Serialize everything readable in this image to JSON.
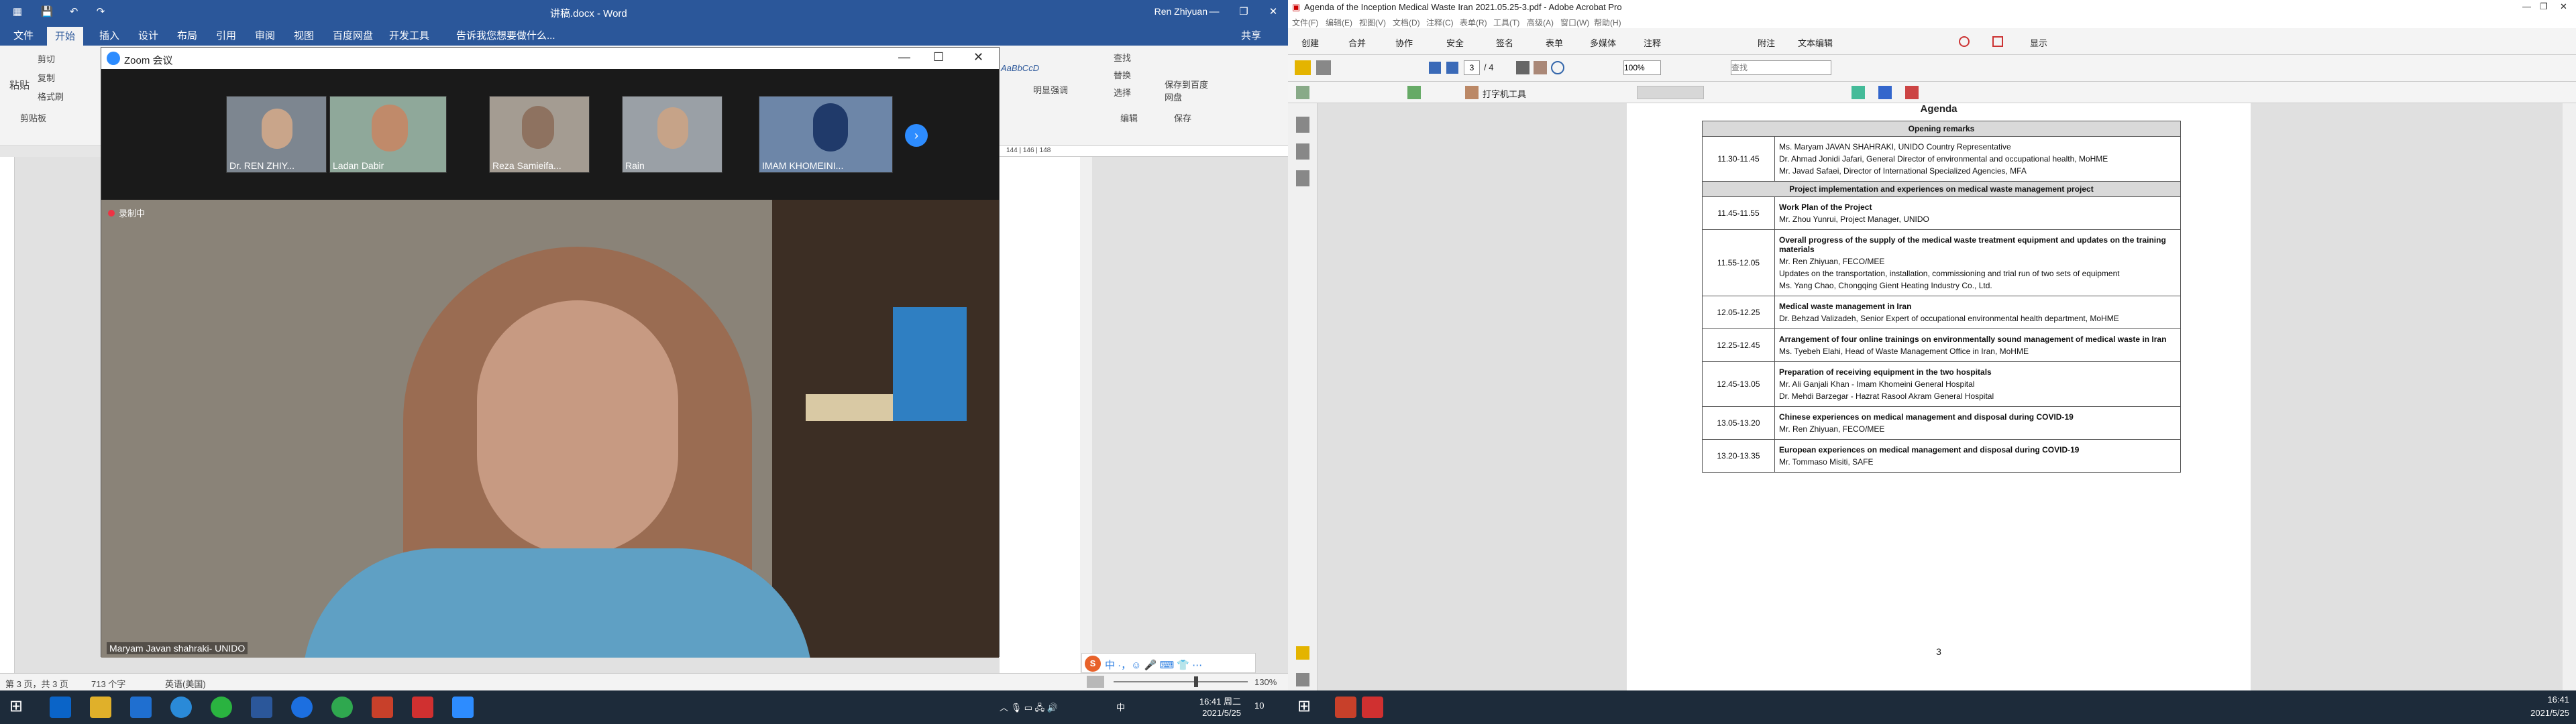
{
  "word": {
    "title": "讲稿.docx - Word",
    "user": "Ren Zhiyuan",
    "share": "共享",
    "tabs": [
      "文件",
      "开始",
      "插入",
      "设计",
      "布局",
      "引用",
      "审阅",
      "视图",
      "百度网盘",
      "开发工具"
    ],
    "tell_me": "告诉我您想要做什么...",
    "ribbon": {
      "paste": "粘贴",
      "cut": "剪切",
      "copy": "复制",
      "format_painter": "格式刷",
      "clipboard": "剪贴板",
      "find": "查找",
      "replace": "替换",
      "select": "选择",
      "editing": "编辑",
      "style1": "AaBbCcD",
      "style1_name": "明显强调",
      "save_cloud": "保存到百度网盘",
      "save": "保存"
    },
    "ruler_marks": "144 | 146 | 148",
    "status": {
      "page": "第 3 页，共 3 页",
      "words": "713 个字",
      "lang": "英语(美国)",
      "zoom": "130%"
    }
  },
  "zoom": {
    "title": "Zoom 会议",
    "recording": "录制中",
    "speaker": "Maryam Javan shahraki- UNIDO",
    "participants": [
      "Dr. REN ZHIY...",
      "Ladan Dabir",
      "Reza Samieifa...",
      "Rain",
      "IMAM KHOMEINI..."
    ]
  },
  "acrobat": {
    "title": "Agenda of the Inception Medical Waste  Iran  2021.05.25-3.pdf - Adobe Acrobat Pro",
    "menu": [
      "文件(F)",
      "编辑(E)",
      "视图(V)",
      "文档(D)",
      "注释(C)",
      "表单(R)",
      "工具(T)",
      "高级(A)",
      "窗口(W)",
      "帮助(H)"
    ],
    "toolbar": [
      "创建",
      "合并",
      "协作",
      "安全",
      "签名",
      "表单",
      "多媒体",
      "注释",
      "附注",
      "文本编辑",
      "显示"
    ],
    "page_current": "3",
    "page_total": "/ 4",
    "zoom": "100%",
    "find_placeholder": "查找",
    "typewriter": "打字机工具",
    "agenda_title": "Agenda",
    "page_number": "3",
    "rows": [
      {
        "type": "section",
        "text": "Opening remarks"
      },
      {
        "type": "row",
        "time": "11.30-11.45",
        "lines": [
          {
            "t": "Ms. Maryam JAVAN SHAHRAKI, UNIDO Country Representative",
            "b": false
          },
          {
            "t": "Dr. Ahmad Jonidi Jafari, General Director of environmental and occupational health, MoHME",
            "b": false
          },
          {
            "t": "Mr. Javad Safaei, Director of International Specialized Agencies, MFA",
            "b": false
          }
        ]
      },
      {
        "type": "section",
        "text": "Project implementation and experiences on medical waste management project"
      },
      {
        "type": "row",
        "time": "11.45-11.55",
        "lines": [
          {
            "t": "Work Plan of the Project",
            "b": true
          },
          {
            "t": "Mr. Zhou Yunrui, Project Manager, UNIDO",
            "b": false
          }
        ]
      },
      {
        "type": "row",
        "time": "11.55-12.05",
        "lines": [
          {
            "t": "Overall progress of the supply of the medical waste treatment equipment and updates on the training materials",
            "b": true
          },
          {
            "t": "Mr. Ren Zhiyuan, FECO/MEE",
            "b": false
          },
          {
            "t": "Updates on the transportation, installation, commissioning and trial run of two sets of equipment",
            "b": false
          },
          {
            "t": "Ms. Yang Chao, Chongqing Gient Heating Industry Co., Ltd.",
            "b": false
          }
        ]
      },
      {
        "type": "row",
        "time": "12.05-12.25",
        "lines": [
          {
            "t": "Medical waste management in Iran",
            "b": true
          },
          {
            "t": "Dr. Behzad Valizadeh, Senior Expert of occupational environmental health department, MoHME",
            "b": false
          }
        ]
      },
      {
        "type": "row",
        "time": "12.25-12.45",
        "lines": [
          {
            "t": "Arrangement of four online trainings on environmentally sound management of medical waste in Iran",
            "b": true
          },
          {
            "t": "Ms. Tyebeh Elahi, Head of Waste Management Office in Iran, MoHME",
            "b": false
          }
        ]
      },
      {
        "type": "row",
        "time": "12.45-13.05",
        "lines": [
          {
            "t": "Preparation of receiving equipment in the two  hospitals",
            "b": true
          },
          {
            "t": "Mr. Ali Ganjali Khan - Imam Khomeini General Hospital",
            "b": false
          },
          {
            "t": "Dr. Mehdi Barzegar  - Hazrat Rasool Akram General Hospital",
            "b": false
          }
        ]
      },
      {
        "type": "row",
        "time": "13.05-13.20",
        "lines": [
          {
            "t": "Chinese experiences on medical management and disposal during COVID-19",
            "b": true
          },
          {
            "t": "Mr. Ren Zhiyuan, FECO/MEE",
            "b": false
          }
        ]
      },
      {
        "type": "row",
        "time": "13.20-13.35",
        "lines": [
          {
            "t": "European experiences on medical management and disposal during COVID-19",
            "b": true
          },
          {
            "t": "Mr. Tommaso Misiti, SAFE",
            "b": false
          }
        ]
      }
    ]
  },
  "taskbar_left": {
    "time": "16:41 周二",
    "date": "2021/5/25",
    "ime": "中",
    "notif": "10"
  },
  "taskbar_right": {
    "time": "16:41",
    "date": "2021/5/25"
  }
}
